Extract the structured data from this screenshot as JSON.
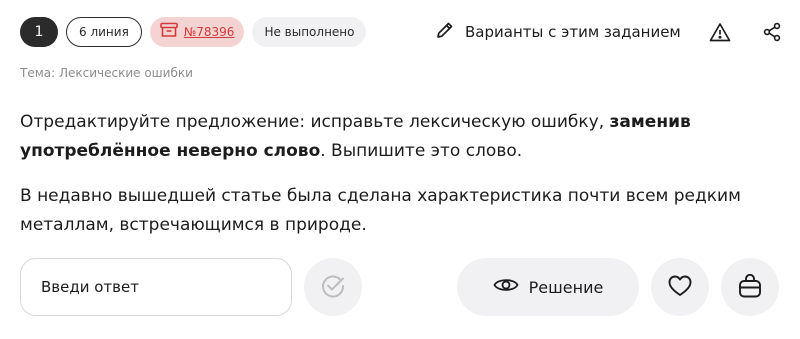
{
  "header": {
    "task_number": "1",
    "line_label": "6 линия",
    "task_id": "№78396",
    "status": "Не выполнено",
    "variants_label": "Варианты с этим заданием"
  },
  "topic": "Тема: Лексические ошибки",
  "task": {
    "text_part1": "Отредактируйте предложение: исправьте лексическую ошибку,",
    "text_bold": "заменив употреблённое неверно слово",
    "text_part2": ". Выпишите это слово."
  },
  "sentence": "В недавно вышедшей статье была сделана характеристика почти всем редким металлам, встречающимся в природе.",
  "answer": {
    "placeholder": "Введи ответ",
    "value": ""
  },
  "actions": {
    "solution_label": "Решение"
  },
  "icons": {
    "archive": "archive-icon",
    "pencil": "pencil-icon",
    "warning": "warning-icon",
    "share": "share-icon",
    "check": "check-circle-icon",
    "eye": "eye-icon",
    "heart": "heart-icon",
    "bag": "bag-icon"
  },
  "colors": {
    "accent_red": "#d23b3b",
    "id_badge_bg": "#f6d3d3",
    "dark_badge": "#2b2b2b",
    "button_bg": "#f1f1f3"
  }
}
